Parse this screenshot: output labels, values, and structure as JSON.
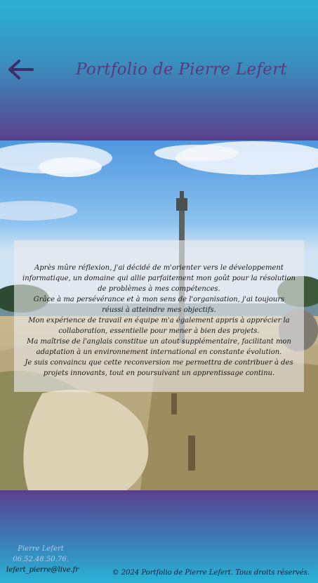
{
  "header": {
    "title": "Portfolio de Pierre Lefert",
    "back_icon": "arrow-left-icon"
  },
  "hero": {
    "image": "coastal-landscape-with-stone-cross",
    "paragraphs": [
      "Après mûre réflexion, j'ai décidé de m'orienter vers le développement informatique, un domaine qui allie parfaitement mon goût pour la résolution de problèmes à mes compétences.",
      "Grâce à ma persévérance et à mon sens de l'organisation, j'ai toujours réussi à atteindre mes objectifs.",
      "Mon expérience de travail en équipe m'a également appris à apprécier la collaboration, essentielle pour mener à bien des projets.",
      "Ma maîtrise de l'anglais constitue un atout supplémentaire, facilitant mon adaptation à un environnement international en constante évolution.",
      "Je suis convaincu que cette reconversion me permettra de contribuer à des projets innovants, tout en poursuivant un apprentissage continu."
    ]
  },
  "footer": {
    "name": "Pierre Lefert",
    "phone": "06.52.48.50.76.",
    "email": "lefert_pierre@live.fr",
    "copyright": "© 2024 Portfolio de Pierre Lefert. Tous droits réservés."
  }
}
